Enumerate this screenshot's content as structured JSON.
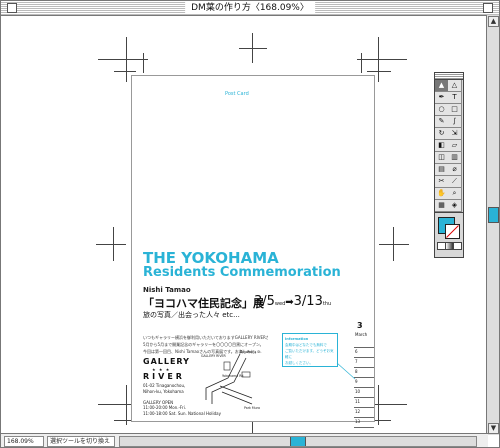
{
  "window": {
    "title": "DM葉の作り方〈168.09%〉"
  },
  "status": {
    "zoom": "168.09%",
    "tool": "選択ツールを切り換え"
  },
  "colors": {
    "accent": "#2ab3d6"
  },
  "document": {
    "postcard_label": "Post Card",
    "headline_line1": "THE YOKOHAMA",
    "headline_line2": "Residents Commemoration",
    "artist": "Nishi Tamao",
    "exhibition": "「ヨコハマ住民記念」展",
    "date_start": "3/5",
    "date_start_day": "wed",
    "date_arrow": "➡",
    "date_end": "3/13",
    "date_end_day": "thu",
    "subtitle": "旅の写真／出会った人々 etc...",
    "body_lines": [
      "いつもギャラリー横浜を御利用いただいておりますGALLERY RIVERが",
      "5月から5月まで開業記念のギャラリーを〇〇〇〇目黒にオープン。",
      "今回は第一回目、Nishi Tamaoさんの写真展です。お楽しみに。"
    ],
    "info_title": "Information",
    "info_lines": [
      "会期中はどなたでも無料で",
      "ご覧いただけます。どうぞお気軽に",
      "お越しください。"
    ],
    "calendar_number": "3",
    "calendar_month": "March",
    "calendar_days": [
      "",
      "6",
      "7",
      "8",
      "9",
      "10",
      "11",
      "12",
      "13",
      ""
    ],
    "gallery_name": "GALLERY",
    "gallery_stars": "★ ★ ★",
    "gallery_river": "RIVER",
    "address_lines": [
      "01-02 Tinaganochou,",
      "Nihon-ku, Yokohama",
      "",
      "GALLERY OPEN",
      "11:00-20:00 Mon.-Fri.",
      "11:00-18:00 Sat. Sun. National Holiday"
    ],
    "map_labels": {
      "gallery": "GALLERY RIVER",
      "station": "Yokohama St.",
      "park": "Park Mura",
      "road": "Yokohama Rd."
    }
  },
  "toolbox": {
    "tools": [
      "selection",
      "direct-selection",
      "pen",
      "type",
      "ellipse",
      "rectangle",
      "pencil",
      "paintbrush",
      "rotate",
      "scale",
      "reflect",
      "shear",
      "blend",
      "graph",
      "gradient",
      "eyedropper",
      "scissors",
      "knife",
      "hand",
      "zoom",
      "grid",
      "symbol"
    ]
  }
}
